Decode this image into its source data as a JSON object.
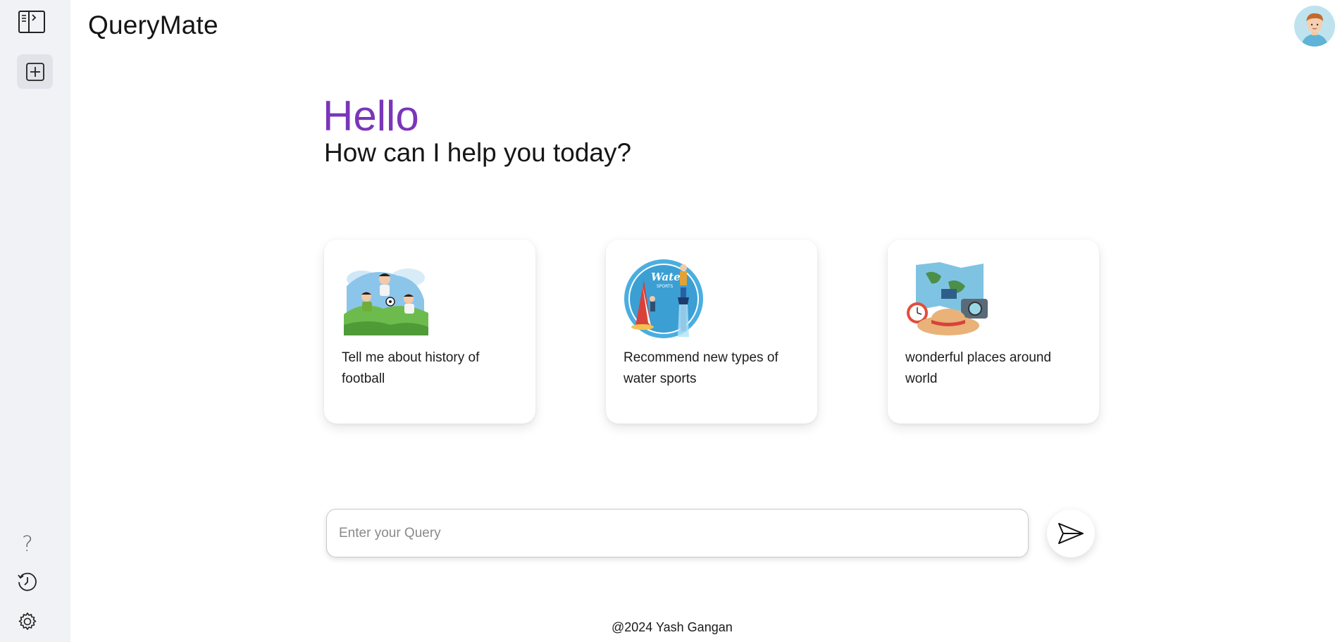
{
  "app": {
    "name": "QueryMate"
  },
  "greeting": {
    "hello": "Hello",
    "subtitle": "How can I help you today?"
  },
  "cards": [
    {
      "text": "Tell me about history of football",
      "icon": "football-illustration"
    },
    {
      "text": "Recommend new types of water sports",
      "icon": "water-sports-illustration"
    },
    {
      "text": "wonderful places around world",
      "icon": "travel-illustration"
    }
  ],
  "query": {
    "placeholder": "Enter your Query",
    "value": ""
  },
  "footer": {
    "text": "@2024 Yash Gangan"
  },
  "sidebar": {
    "items": [
      {
        "icon": "sidebar-toggle-icon"
      },
      {
        "icon": "new-chat-icon"
      },
      {
        "icon": "help-icon",
        "glyph": "?"
      },
      {
        "icon": "history-icon"
      },
      {
        "icon": "settings-icon"
      }
    ]
  },
  "colors": {
    "accent": "#7a36b9",
    "sidebar_bg": "#f0f2f5"
  }
}
